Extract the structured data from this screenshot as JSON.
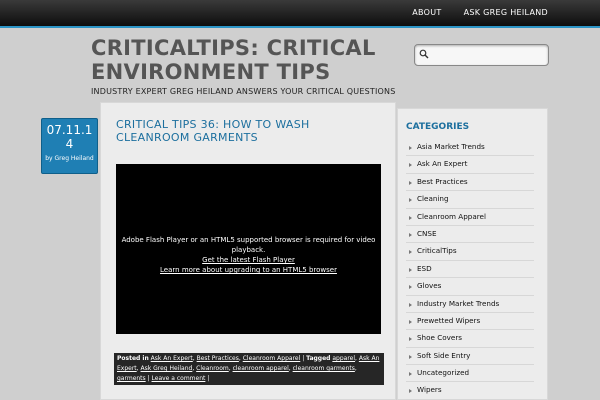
{
  "nav": {
    "items": [
      "ABOUT",
      "ASK GREG HEILAND"
    ]
  },
  "site": {
    "title": "CRITICALTIPS: CRITICAL ENVIRONMENT TIPS",
    "tagline": "INDUSTRY EXPERT GREG HEILAND ANSWERS YOUR CRITICAL QUESTIONS"
  },
  "search": {
    "placeholder": ""
  },
  "post": {
    "date": "07.11.14",
    "by_line": "by Greg Heiland",
    "title": "CRITICAL TIPS 36: HOW TO WASH CLEANROOM GARMENTS",
    "video": {
      "message": "Adobe Flash Player or an HTML5 supported browser is required for video playback.",
      "link1": "Get the latest Flash Player",
      "link2": "Learn more about upgrading to an HTML5 browser"
    },
    "meta": {
      "posted_in": "Posted in",
      "categories": [
        "Ask An Expert",
        "Best Practices",
        "Cleanroom Apparel"
      ],
      "tagged": "Tagged",
      "tags": [
        "apparel",
        "Ask An Expert",
        "Ask Greg Heiland",
        "Cleanroom",
        "cleanroom apparel",
        "cleanroom garments",
        "garments"
      ],
      "comment": "Leave a comment"
    }
  },
  "sidebar": {
    "heading": "CATEGORIES",
    "categories": [
      "Asia Market Trends",
      "Ask An Expert",
      "Best Practices",
      "Cleaning",
      "Cleanroom Apparel",
      "CNSE",
      "CriticalTips",
      "ESD",
      "Gloves",
      "Industry Market Trends",
      "Prewetted Wipers",
      "Shoe Covers",
      "Soft Side Entry",
      "Uncategorized",
      "Wipers"
    ]
  }
}
